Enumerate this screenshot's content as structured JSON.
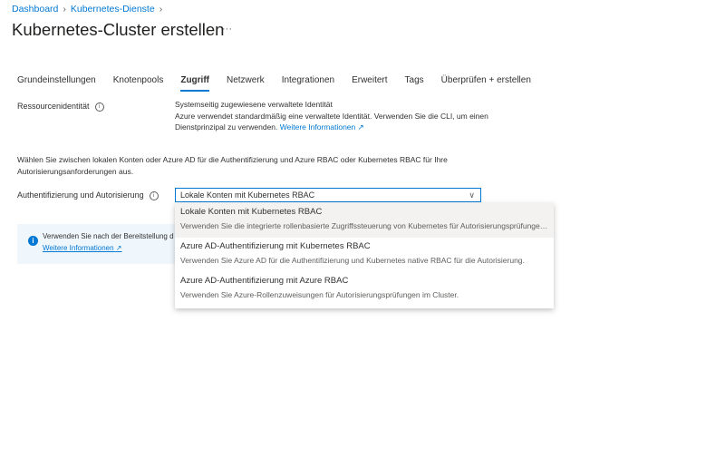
{
  "breadcrumb": [
    "Dashboard",
    "Kubernetes-Dienste"
  ],
  "title": "Kubernetes-Cluster erstellen",
  "more": "···",
  "tabs": [
    "Grundeinstellungen",
    "Knotenpools",
    "Zugriff",
    "Netzwerk",
    "Integrationen",
    "Erweitert",
    "Tags",
    "Überprüfen + erstellen"
  ],
  "identity": {
    "label": "Ressourcenidentität",
    "line1": "Systemseitig zugewiesene verwaltete Identität",
    "line2": "Azure verwendet standardmäßig eine verwaltete Identität. Verwenden Sie die CLI, um einen Dienstprinzipal zu verwenden.",
    "link": "Weitere Informationen"
  },
  "auth_intro": "Wählen Sie zwischen lokalen Konten oder Azure AD für die Authentifizierung und Azure RBAC oder Kubernetes RBAC für Ihre Autorisierungsanforderungen aus.",
  "auth": {
    "label": "Authentifizierung und Autorisierung",
    "value": "Lokale Konten mit Kubernetes RBAC"
  },
  "infobox": {
    "text": "Verwenden Sie nach der Bereitstellung d",
    "link": "Weitere Informationen"
  },
  "options": [
    {
      "title": "Lokale Konten mit Kubernetes RBAC",
      "desc": "Verwenden Sie die integrierte rollenbasierte Zugriffssteuerung von Kubernetes für Autorisierungsprüfungen im Cluster."
    },
    {
      "title": "Azure AD-Authentifizierung mit Kubernetes RBAC",
      "desc": "Verwenden Sie Azure AD für die Authentifizierung und Kubernetes native RBAC für die Autorisierung."
    },
    {
      "title": "Azure AD-Authentifizierung mit Azure RBAC",
      "desc": "Verwenden Sie Azure-Rollenzuweisungen für Autorisierungsprüfungen im Cluster."
    }
  ]
}
